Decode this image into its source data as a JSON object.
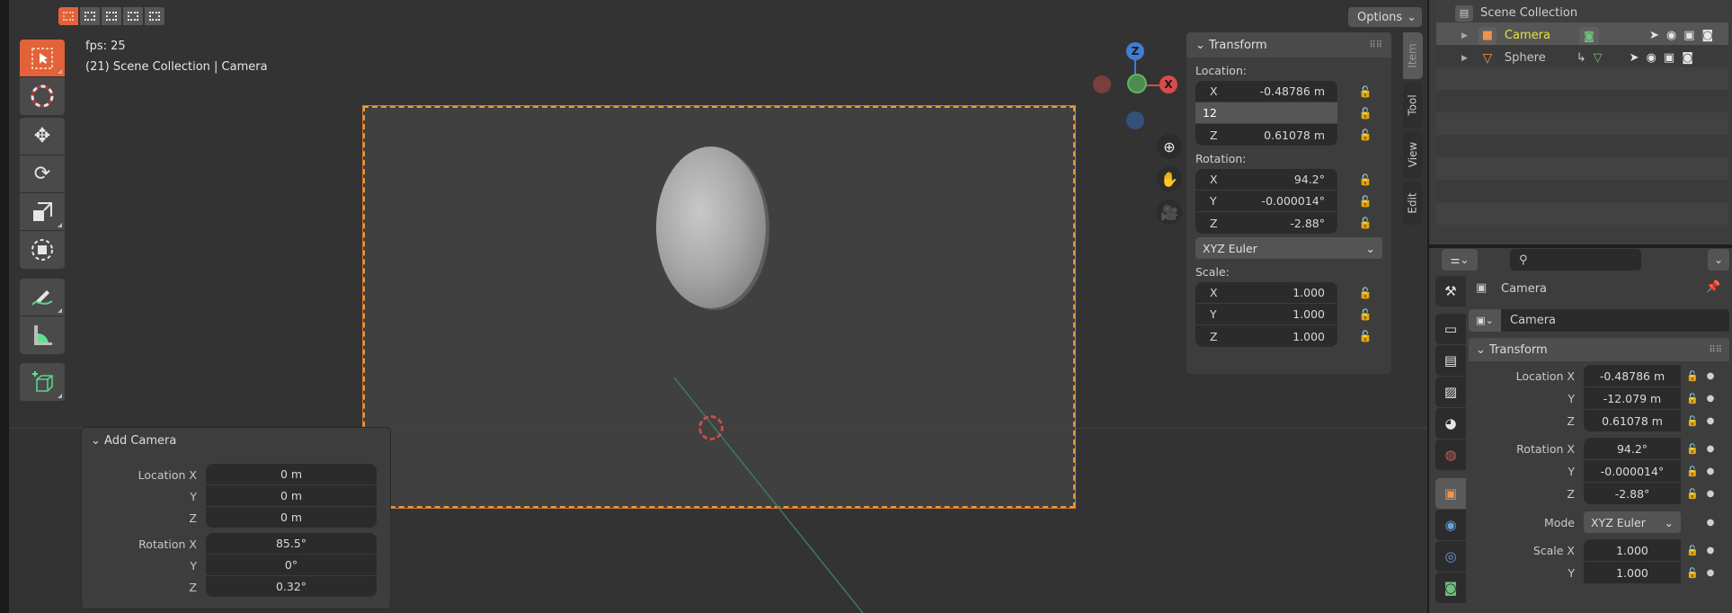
{
  "viewport": {
    "fps_label": "fps: 25",
    "scene_info": "(21) Scene Collection | Camera",
    "options_label": "Options",
    "select_modes": [
      "select-new-icon",
      "select-extend-icon",
      "select-subtract-icon",
      "select-invert-icon",
      "select-intersect-icon"
    ],
    "tools": [
      "select-box",
      "cursor",
      "move",
      "rotate",
      "scale",
      "transform",
      "annotate",
      "measure",
      "add-cube"
    ],
    "gizmo": {
      "x_label": "X",
      "y_label": "",
      "z_label": "Z"
    },
    "colors": {
      "accent": "#e2623a",
      "camera_frame": "#e29a3e",
      "axis_x": "#d94b4b",
      "axis_y": "#5cb85c",
      "axis_z": "#3f7fd1"
    }
  },
  "npanel": {
    "header": "Transform",
    "location_label": "Location:",
    "location": [
      {
        "axis": "X",
        "value": "-0.48786 m"
      },
      {
        "axis": "",
        "value": "12",
        "editing": true
      },
      {
        "axis": "Z",
        "value": "0.61078 m"
      }
    ],
    "rotation_label": "Rotation:",
    "rotation": [
      {
        "axis": "X",
        "value": "94.2°"
      },
      {
        "axis": "Y",
        "value": "-0.000014°"
      },
      {
        "axis": "Z",
        "value": "-2.88°"
      }
    ],
    "rotation_mode": "XYZ Euler",
    "scale_label": "Scale:",
    "scale": [
      {
        "axis": "X",
        "value": "1.000"
      },
      {
        "axis": "Y",
        "value": "1.000"
      },
      {
        "axis": "Z",
        "value": "1.000"
      }
    ],
    "tabs": [
      "Item",
      "Tool",
      "View",
      "Edit"
    ]
  },
  "add_camera": {
    "header": "Add Camera",
    "rows": [
      {
        "label": "Location X",
        "value": "0 m"
      },
      {
        "label": "Y",
        "value": "0 m"
      },
      {
        "label": "Z",
        "value": "0 m"
      },
      {
        "label": "Rotation X",
        "value": "85.5°"
      },
      {
        "label": "Y",
        "value": "0°"
      },
      {
        "label": "Z",
        "value": "0.32°"
      }
    ]
  },
  "outliner": {
    "root": "Scene Collection",
    "items": [
      {
        "name": "Camera",
        "selected": true
      },
      {
        "name": "Sphere",
        "selected": false
      }
    ]
  },
  "properties": {
    "search_placeholder": "",
    "object_name": "Camera",
    "datablock_name": "Camera",
    "section": "Transform",
    "rows": [
      {
        "label": "Location X",
        "value": "-0.48786 m"
      },
      {
        "label": "Y",
        "value": "-12.079 m"
      },
      {
        "label": "Z",
        "value": "0.61078 m"
      },
      {
        "label": "Rotation X",
        "value": "94.2°"
      },
      {
        "label": "Y",
        "value": "-0.000014°"
      },
      {
        "label": "Z",
        "value": "-2.88°"
      },
      {
        "label": "Mode",
        "value": "XYZ Euler"
      },
      {
        "label": "Scale X",
        "value": "1.000"
      },
      {
        "label": "Y",
        "value": "1.000"
      }
    ]
  }
}
